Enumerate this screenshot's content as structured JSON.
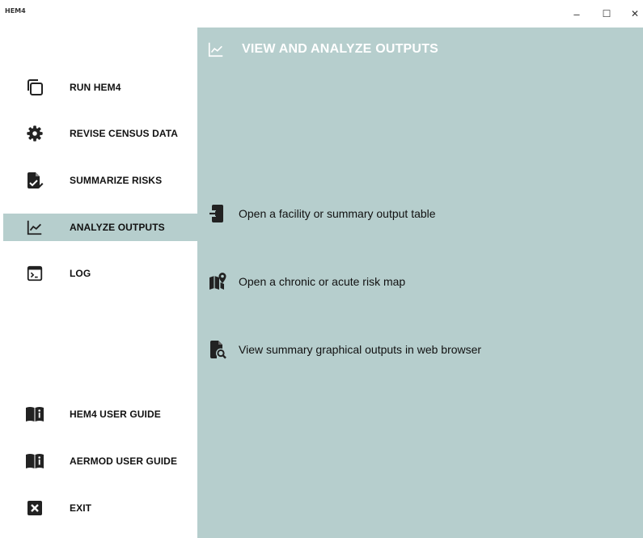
{
  "window": {
    "app_title": "HEM4",
    "minimize": "–",
    "maximize": "☐",
    "close": "✕"
  },
  "sidebar": {
    "items": [
      {
        "label": "RUN HEM4",
        "icon": "copy-icon"
      },
      {
        "label": "REVISE CENSUS DATA",
        "icon": "gear-icon"
      },
      {
        "label": "SUMMARIZE RISKS",
        "icon": "document-edit-icon"
      },
      {
        "label": "ANALYZE OUTPUTS",
        "icon": "line-chart-icon",
        "active": true
      },
      {
        "label": "LOG",
        "icon": "terminal-icon"
      },
      {
        "label": "HEM4 USER GUIDE",
        "icon": "book-info-icon"
      },
      {
        "label": "AERMOD USER GUIDE",
        "icon": "book-info-icon"
      },
      {
        "label": "EXIT",
        "icon": "close-box-icon"
      }
    ]
  },
  "main": {
    "title": "VIEW AND ANALYZE OUTPUTS",
    "title_icon": "line-chart-icon",
    "actions": [
      {
        "label": "Open a facility or summary output table",
        "icon": "file-import-icon"
      },
      {
        "label": "Open a chronic or acute risk map",
        "icon": "map-marker-icon"
      },
      {
        "label": "View summary graphical outputs in web browser",
        "icon": "file-search-icon"
      }
    ]
  },
  "colors": {
    "accent": "#b6cecd",
    "title_text": "#ffffff",
    "background": "#ffffff"
  }
}
